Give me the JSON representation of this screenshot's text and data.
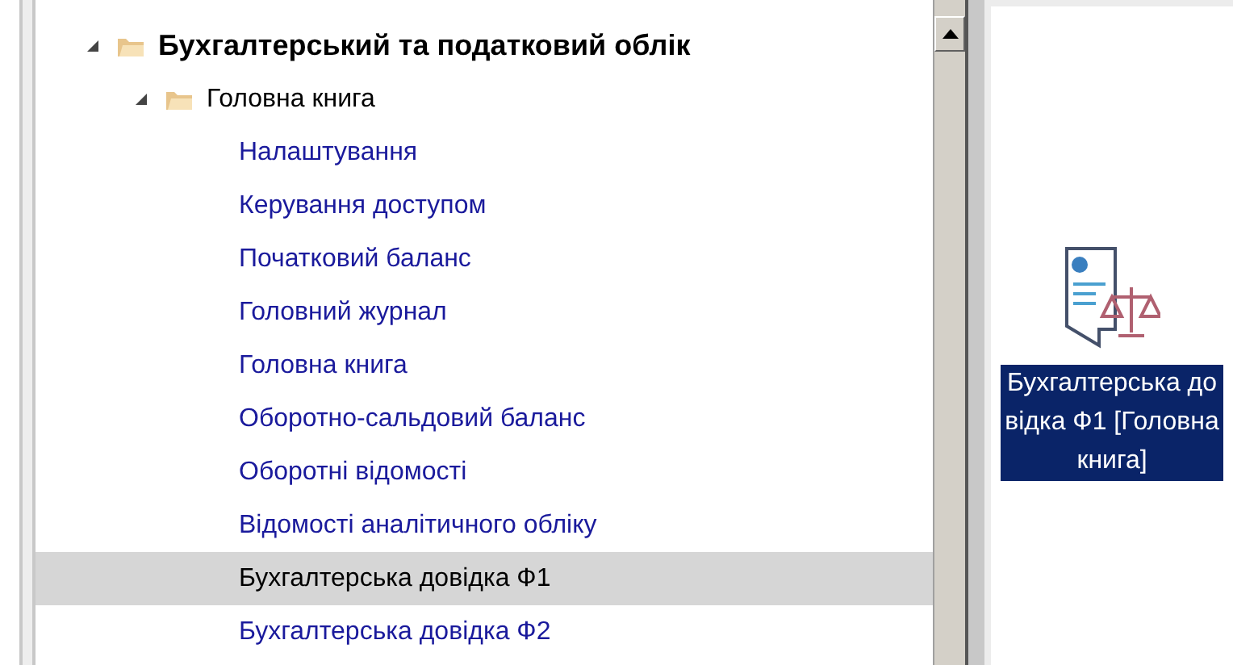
{
  "tree": [
    {
      "label": "Бухгалтерський та податковий облік",
      "expanded": true,
      "children": [
        {
          "label": "Головна книга",
          "expanded": true,
          "children": [
            {
              "label": "Налаштування",
              "selected": false
            },
            {
              "label": "Керування доступом",
              "selected": false
            },
            {
              "label": "Початковий баланс",
              "selected": false
            },
            {
              "label": "Головний журнал",
              "selected": false
            },
            {
              "label": "Головна книга",
              "selected": false
            },
            {
              "label": "Оборотно-сальдовий баланс",
              "selected": false
            },
            {
              "label": "Оборотні відомості",
              "selected": false
            },
            {
              "label": "Відомості аналітичного обліку",
              "selected": false
            },
            {
              "label": "Бухгалтерська довідка Ф1",
              "selected": true
            },
            {
              "label": "Бухгалтерська довідка Ф2",
              "selected": false
            }
          ]
        }
      ]
    }
  ],
  "shortcut": {
    "label": "Бухгалтерська довідка Ф1 [Головна книга]",
    "selected": true
  }
}
